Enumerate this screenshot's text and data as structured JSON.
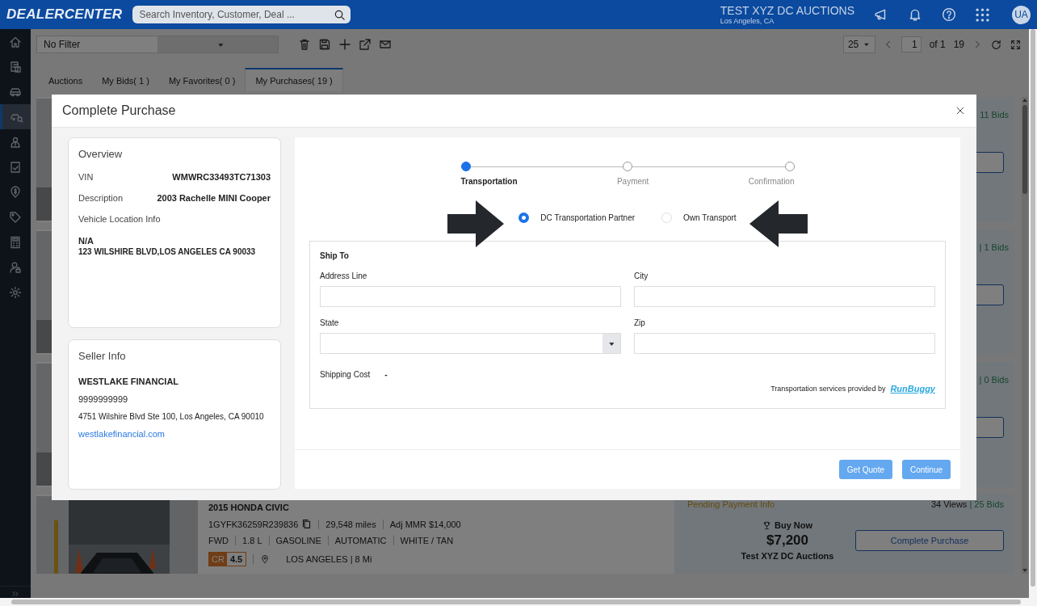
{
  "header": {
    "logo": "DEALERCENTER",
    "search_placeholder": "Search Inventory, Customer, Deal ...",
    "dealer": "TEST XYZ DC AUCTIONS",
    "location": "Los Angeles, CA",
    "avatar": "UA"
  },
  "sidebar": {
    "items": [
      {
        "kind": "home",
        "selected": false
      },
      {
        "kind": "documents",
        "selected": false
      },
      {
        "kind": "car",
        "selected": false
      },
      {
        "kind": "car-search",
        "selected": true
      },
      {
        "kind": "person",
        "selected": false
      },
      {
        "kind": "checklist",
        "selected": false
      },
      {
        "kind": "pin",
        "selected": false
      },
      {
        "kind": "tag",
        "selected": false
      },
      {
        "kind": "calculator",
        "selected": false
      },
      {
        "kind": "user-lock",
        "selected": false
      },
      {
        "kind": "gear",
        "selected": false
      }
    ]
  },
  "toolbar": {
    "filter": "No Filter",
    "page_size": "25",
    "page": "1",
    "page_count": "of 1",
    "total": "19"
  },
  "tabs": [
    {
      "label": "Auctions",
      "selected": false
    },
    {
      "label": "My Bids( 1 )",
      "selected": false
    },
    {
      "label": "My Favorites( 0 )",
      "selected": false
    },
    {
      "label": "My Purchases( 19 )",
      "selected": true
    }
  ],
  "listings": [
    {
      "kind": "covered",
      "bids": "11 Bids"
    },
    {
      "kind": "covered",
      "bids": "| 1 Bids"
    },
    {
      "kind": "covered",
      "bids": "| 0 Bids"
    },
    {
      "kind": "full",
      "title": "2015 HONDA CIVIC",
      "vin": "1GYFK36259R239836",
      "specs": [
        "29,548 miles",
        "Adj MMR $14,000"
      ],
      "details": [
        "FWD",
        "1.8 L",
        "GASOLINE",
        "AUTOMATIC",
        "WHITE / TAN"
      ],
      "cr_label": "CR",
      "cr": "4.5",
      "location": "LOS ANGELES | 8 Mi",
      "status": "Pending Payment Info",
      "views": "34 Views",
      "bids": "| 25 Bids",
      "sale_type": "Buy Now",
      "price": "$7,200",
      "auction": "Test XYZ DC Auctions",
      "action": "Complete Purchase"
    }
  ],
  "modal": {
    "title": "Complete Purchase",
    "overview": {
      "heading": "Overview",
      "rows": [
        {
          "label": "VIN",
          "value": "WMWRC33493TC71303"
        },
        {
          "label": "Description",
          "value": "2003 Rachelle MINI Cooper"
        }
      ],
      "location_label": "Vehicle Location Info",
      "location_name": "N/A",
      "location_address": "123 WILSHIRE BLVD,LOS ANGELES CA 90033"
    },
    "seller": {
      "heading": "Seller Info",
      "name": "WESTLAKE FINANCIAL",
      "phone": "9999999999",
      "address": "4751 Wilshire Blvd Ste 100, Los Angeles, CA 90010",
      "website": "westlakefinancial.com"
    },
    "steps": [
      {
        "label": "Transportation",
        "active": true
      },
      {
        "label": "Payment",
        "active": false
      },
      {
        "label": "Confirmation",
        "active": false
      }
    ],
    "transport_options": [
      {
        "label": "DC Transportation Partner",
        "selected": true
      },
      {
        "label": "Own Transport",
        "selected": false
      }
    ],
    "ship_to": {
      "heading": "Ship To",
      "fields": [
        {
          "label": "Address Line",
          "kind": "text"
        },
        {
          "label": "City",
          "kind": "text"
        },
        {
          "label": "State",
          "kind": "select"
        },
        {
          "label": "Zip",
          "kind": "text"
        }
      ],
      "shipping_cost_label": "Shipping Cost",
      "shipping_cost": "-",
      "provider_text": "Transportation services provided by",
      "provider_logo": "RunBuggy"
    },
    "buttons": [
      {
        "label": "Get Quote",
        "disabled": true
      },
      {
        "label": "Continue",
        "disabled": true
      }
    ]
  }
}
